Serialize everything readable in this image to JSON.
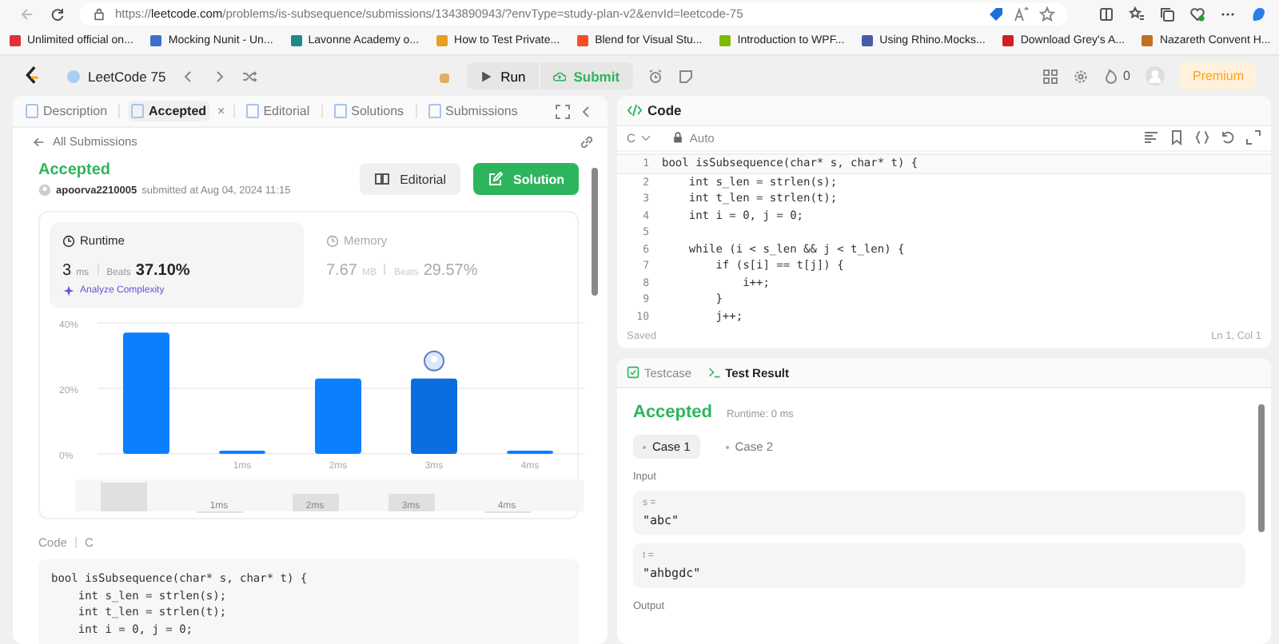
{
  "browser": {
    "url": "https://**leetcode.com**/problems/is-subsequence/submissions/1343890943/?envType=study-plan-v2&envId=leetcode-75"
  },
  "bookmarks": [
    {
      "label": "Unlimited official on...",
      "color": "#e0303c"
    },
    {
      "label": "Mocking Nunit - Un...",
      "color": "#3a6fd0"
    },
    {
      "label": "Lavonne Academy o...",
      "color": "#1f8a8a"
    },
    {
      "label": "How to Test Private...",
      "color": "#e8a020"
    },
    {
      "label": "Blend for Visual Stu...",
      "color": "#f25022"
    },
    {
      "label": "Introduction to WPF...",
      "color": "#7fba00"
    },
    {
      "label": "Using Rhino.Mocks...",
      "color": "#4a5aa8"
    },
    {
      "label": "Download Grey's A...",
      "color": "#d02020"
    },
    {
      "label": "Nazareth Convent H...",
      "color": "#c07020"
    }
  ],
  "topbar": {
    "list_name": "LeetCode 75",
    "run": "Run",
    "submit": "Submit",
    "streak": "0",
    "premium": "Premium"
  },
  "left_tabs": [
    {
      "label": "Description",
      "selected": false
    },
    {
      "label": "Accepted",
      "selected": true,
      "close_label": "×"
    },
    {
      "label": "Editorial",
      "selected": false
    },
    {
      "label": "Solutions",
      "selected": false
    },
    {
      "label": "Submissions",
      "selected": false
    }
  ],
  "back_link": "All Submissions",
  "submission": {
    "status": "Accepted",
    "user": "apoorva2210005",
    "submitted": "submitted at Aug 04, 2024 11:15",
    "editorial_button": "Editorial",
    "solution_button": "Solution"
  },
  "metrics": [
    {
      "label": "Runtime",
      "value": "3",
      "unit": "ms",
      "beats_label": "Beats",
      "beats": "37.10%",
      "analyze": "Analyze Complexity",
      "selected": true
    },
    {
      "label": "Memory",
      "value": "7.67",
      "unit": "MB",
      "beats_label": "Beats",
      "beats": "29.57%",
      "selected": false
    }
  ],
  "distribution": {
    "chart_data": {
      "type": "bar",
      "categories": [
        null,
        "1ms",
        "2ms",
        "3ms",
        "4ms"
      ],
      "values": [
        37,
        1,
        23,
        23,
        1
      ],
      "ylim": [
        0,
        40
      ],
      "yticks": [
        {
          "value": 0,
          "label": "0%"
        },
        {
          "value": 20,
          "label": "20%"
        },
        {
          "value": 40,
          "label": "40%"
        }
      ],
      "annotations": [
        {
          "x": "3ms"
        }
      ]
    },
    "navigator_labels": [
      "1ms",
      "2ms",
      "3ms",
      "4ms"
    ]
  },
  "code_section": {
    "label": "Code",
    "language": "C",
    "lines": [
      "bool isSubsequence(char* s, char* t) {",
      "    int s_len = strlen(s);",
      "    int t_len = strlen(t);",
      "    int i = 0, j = 0;"
    ]
  },
  "editor": {
    "title": "Code",
    "language": "C",
    "mode": "Auto",
    "lines": [
      {
        "n": "1",
        "code": "bool isSubsequence(char* s, char* t) {"
      },
      {
        "n": "2",
        "code": "    int s_len = strlen(s);"
      },
      {
        "n": "3",
        "code": "    int t_len = strlen(t);"
      },
      {
        "n": "4",
        "code": "    int i = 0, j = 0;"
      },
      {
        "n": "5"
      },
      {
        "n": "6",
        "code": "    while (i < s_len && j < t_len) {"
      },
      {
        "n": "7",
        "code": "        if (s[i] == t[j]) {"
      },
      {
        "n": "8",
        "code": "            i++;"
      },
      {
        "n": "9",
        "code": "        }"
      },
      {
        "n": "10",
        "code": "        j++;"
      }
    ],
    "status": "Saved",
    "cursor": "Ln 1, Col 1"
  },
  "results": {
    "tabs": [
      {
        "label": "Testcase",
        "selected": false
      },
      {
        "label": "Test Result",
        "selected": true
      }
    ],
    "status": "Accepted",
    "runtime": "Runtime: 0 ms",
    "cases": [
      {
        "label": "Case 1",
        "selected": true
      },
      {
        "label": "Case 2",
        "selected": false
      }
    ],
    "input_label": "Input",
    "inputs": [
      {
        "name": "s =",
        "value": "\"abc\""
      },
      {
        "name": "t =",
        "value": "\"ahbgdc\""
      }
    ],
    "output_label": "Output"
  }
}
